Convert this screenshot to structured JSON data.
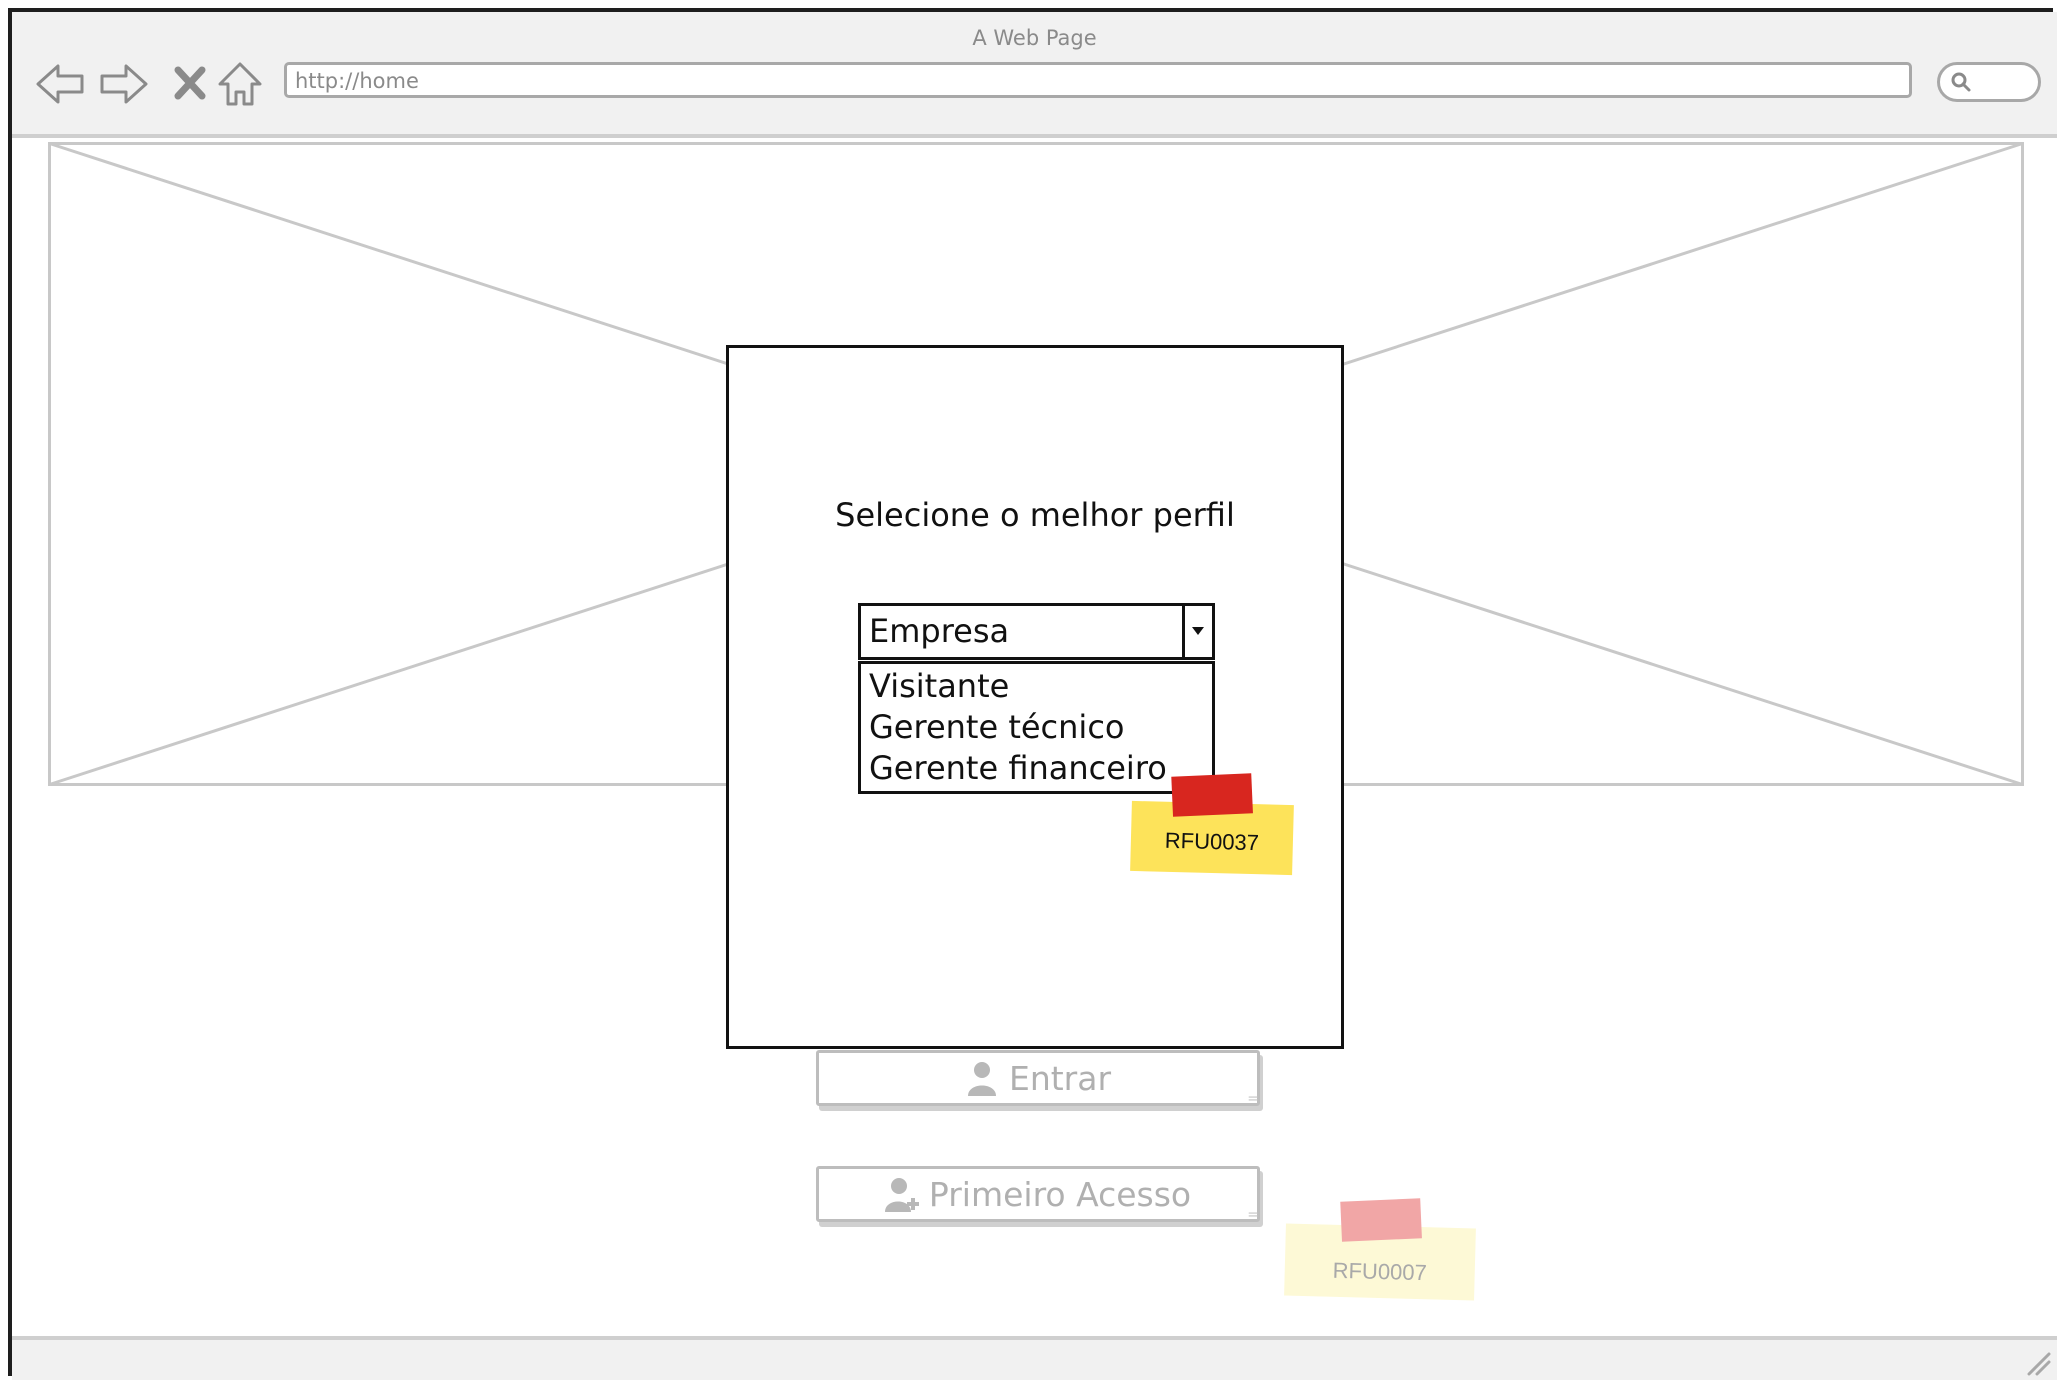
{
  "window": {
    "title": "A Web Page",
    "url": "http://home"
  },
  "background_buttons": {
    "login_label": "Entrar",
    "first_access_label": "Primeiro Acesso"
  },
  "notes": {
    "background_note": "RFU0007",
    "modal_note": "RFU0037"
  },
  "modal": {
    "title": "Selecione o melhor perfil",
    "select": {
      "selected": "Empresa",
      "options": [
        "Visitante",
        "Gerente técnico",
        "Gerente financeiro"
      ]
    }
  },
  "colors": {
    "sticky_yellow": "#fde35a",
    "tape_red": "#d8261f",
    "chrome_gray": "#f1f1f1"
  }
}
